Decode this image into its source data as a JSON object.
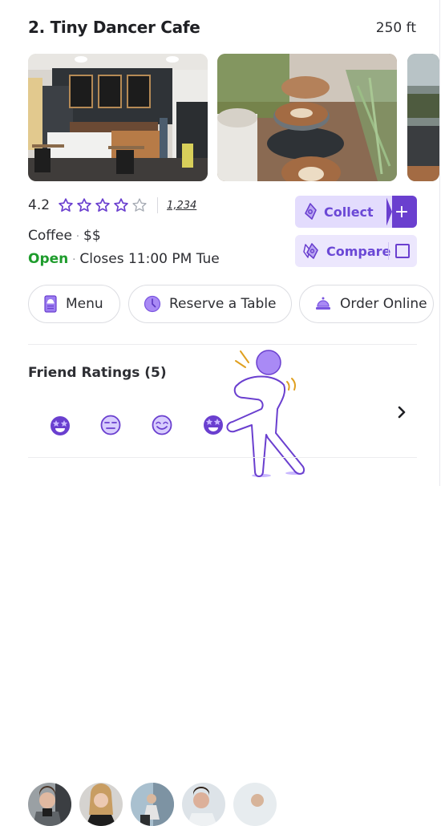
{
  "listing": {
    "title": "2. Tiny Dancer Cafe",
    "distance": "250 ft",
    "photos": [
      "cafe-interior-photo",
      "latte-cups-photo",
      "greenhouse-cafe-photo"
    ],
    "rating": "4.2",
    "stars_filled": 4,
    "stars_total": 5,
    "review_count": "1,234",
    "category": "Coffee",
    "price": "$$",
    "status": "Open",
    "hours": "Closes 11:00 PM Tue",
    "separator": "·"
  },
  "actions": {
    "collect_label": "Collect",
    "collect_plus": "+",
    "compare_label": "Compare"
  },
  "quick_actions": [
    {
      "label": "Menu",
      "icon": "menu-book-icon"
    },
    {
      "label": "Reserve a Table",
      "icon": "clock-icon"
    },
    {
      "label": "Order Online",
      "icon": "service-bell-icon"
    }
  ],
  "friend_ratings": {
    "title": "Friend Ratings (5)",
    "friends": [
      {
        "reaction": "star-eyes-emoji-icon"
      },
      {
        "reaction": "neutral-face-emoji-icon"
      },
      {
        "reaction": "smiling-face-emoji-icon"
      },
      {
        "reaction": "star-eyes-emoji-icon"
      },
      {
        "reaction": "unknown"
      }
    ]
  },
  "colors": {
    "accent": "#6a3fcf",
    "accent_light": "#e3dcfd",
    "open_green": "#1e9c2c",
    "star_empty": "#a5aab3"
  }
}
